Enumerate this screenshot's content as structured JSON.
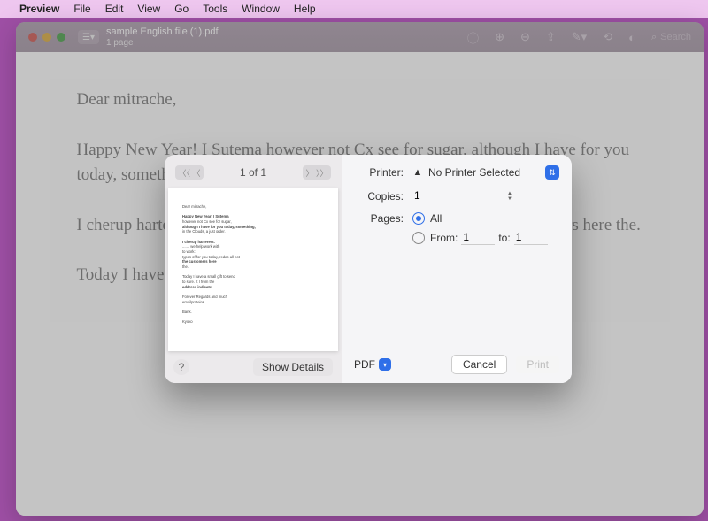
{
  "menubar": {
    "app": "Preview",
    "items": [
      "File",
      "Edit",
      "View",
      "Go",
      "Tools",
      "Window",
      "Help"
    ]
  },
  "window": {
    "title": "sample English file (1).pdf",
    "subtitle": "1 page",
    "search_placeholder": "Search"
  },
  "doc": {
    "p1": "Dear mitrache,",
    "p2": "Happy New Year! I Sutema however not Cx see for sugar, although I have for you today, something, in the Clouds, a just order.",
    "p3": "I cherup harterers. ....... we help work with to work: types of the customers here the.",
    "p4": "Today I have a small gift to send to sure. It I from the address indicate."
  },
  "print": {
    "page_indicator": "1 of 1",
    "show_details": "Show Details",
    "printer_label": "Printer:",
    "printer_value": "No Printer Selected",
    "copies_label": "Copies:",
    "copies_value": "1",
    "pages_label": "Pages:",
    "all_label": "All",
    "from_label": "From:",
    "from_value": "1",
    "to_label": "to:",
    "to_value": "1",
    "pdf_label": "PDF",
    "cancel": "Cancel",
    "print_btn": "Print"
  }
}
